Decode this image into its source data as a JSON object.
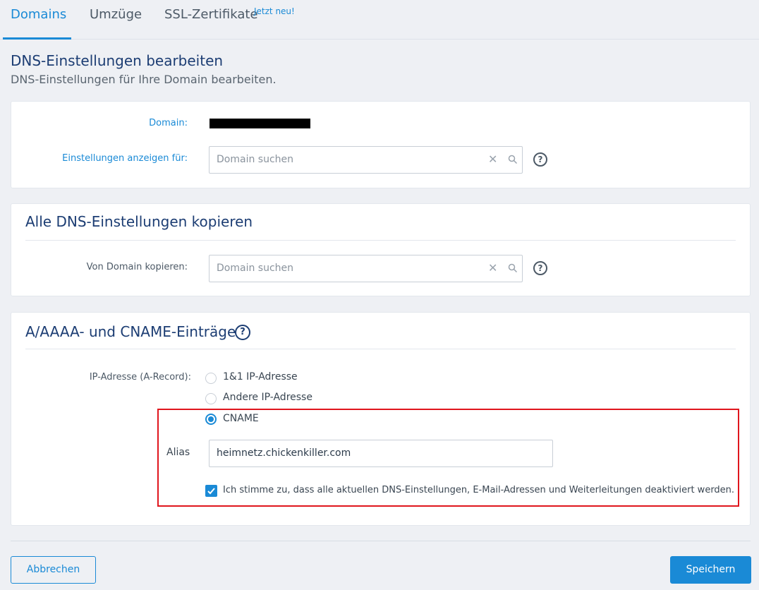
{
  "tabs": [
    {
      "label": "Domains",
      "active": true
    },
    {
      "label": "Umzüge",
      "active": false
    },
    {
      "label": "SSL-Zertifikate",
      "active": false
    }
  ],
  "tab_badge": "Jetzt neu!",
  "page": {
    "title": "DNS-Einstellungen bearbeiten",
    "subtitle": "DNS-Einstellungen für Ihre Domain bearbeiten."
  },
  "domain_card": {
    "domain_label": "Domain:",
    "settings_label": "Einstellungen anzeigen für:",
    "search_placeholder": "Domain suchen"
  },
  "copy_card": {
    "heading": "Alle DNS-Einstellungen kopieren",
    "from_label": "Von Domain kopieren:",
    "search_placeholder": "Domain suchen"
  },
  "records_card": {
    "heading": "A/AAAA- und CNAME-Einträge",
    "ip_label": "IP-Adresse (A-Record):",
    "options": [
      {
        "label": "1&1 IP-Adresse",
        "checked": false
      },
      {
        "label": "Andere IP-Adresse",
        "checked": false
      },
      {
        "label": "CNAME",
        "checked": true
      }
    ],
    "alias_label": "Alias",
    "alias_value": "heimnetz.chickenkiller.com",
    "consent_label": "Ich stimme zu, dass alle aktuellen DNS-Einstellungen, E-Mail-Adressen und Weiterleitungen deaktiviert werden.",
    "consent_checked": true
  },
  "footer": {
    "cancel_label": "Abbrechen",
    "save_label": "Speichern"
  },
  "icons": {
    "clear": "close-icon",
    "search": "search-icon",
    "help": "help-icon",
    "check": "check-icon"
  },
  "colors": {
    "accent": "#1a8ad6",
    "heading": "#1c3d73",
    "highlight": "#e0161d"
  }
}
